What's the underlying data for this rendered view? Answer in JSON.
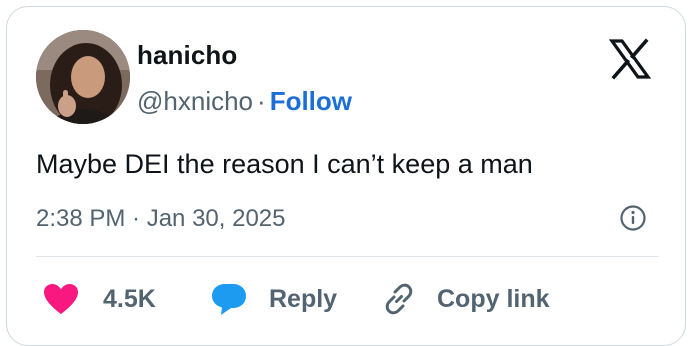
{
  "author": {
    "name": "hanicho",
    "handle": "@hxnicho",
    "separator": "·",
    "follow_label": "Follow",
    "avatar_icon": "profile-photo"
  },
  "tweet": {
    "text": "Maybe DEI the reason I can’t keep a man",
    "timestamp": "2:38 PM · Jan 30, 2025"
  },
  "actions": {
    "like": {
      "icon": "heart-icon",
      "count": "4.5K",
      "color": "#f91880"
    },
    "reply": {
      "icon": "speech-bubble-icon",
      "label": "Reply",
      "color": "#1d9bf0"
    },
    "copy": {
      "icon": "link-icon",
      "label": "Copy link"
    }
  },
  "colors": {
    "follow": "#1d6fd8",
    "muted": "#536471",
    "text": "#0f1419",
    "border": "#cfd9de"
  },
  "logo": "x-logo-icon",
  "info": "info-icon"
}
